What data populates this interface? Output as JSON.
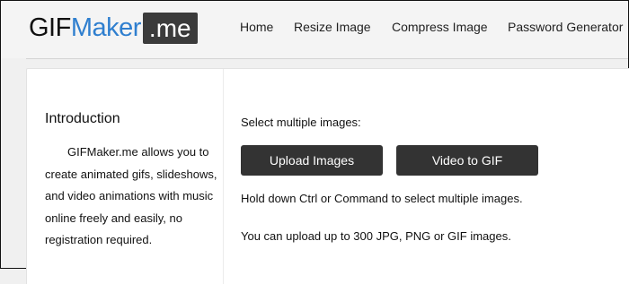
{
  "logo": {
    "part1": "GIF",
    "part2": "Maker",
    "part3": ".me"
  },
  "nav": {
    "items": [
      {
        "label": "Home"
      },
      {
        "label": "Resize Image"
      },
      {
        "label": "Compress Image"
      },
      {
        "label": "Password Generator"
      }
    ]
  },
  "sidebar": {
    "title": "Introduction",
    "text": "GIFMaker.me allows you to create animated gifs, slideshows, and video animations with music online freely and easily, no registration required."
  },
  "main": {
    "select_label": "Select multiple images:",
    "upload_button": "Upload Images",
    "video_button": "Video to GIF",
    "note_ctrl": "Hold down Ctrl or Command to select multiple images.",
    "note_limit": "You can upload up to 300 JPG, PNG or GIF images."
  },
  "colors": {
    "brand_blue": "#2f7fcf",
    "button_dark": "#333333",
    "logo_badge": "#3b3b3b"
  }
}
